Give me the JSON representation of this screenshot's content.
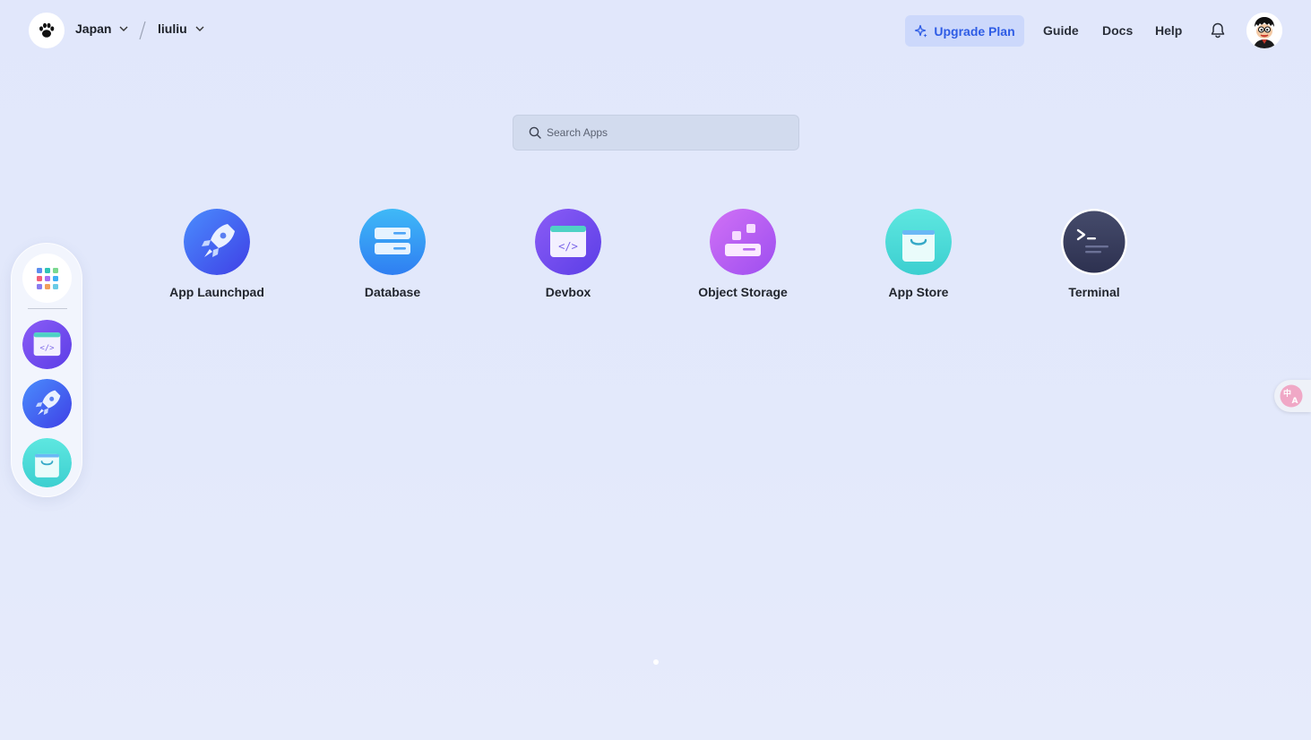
{
  "header": {
    "region": "Japan",
    "workspace": "liuliu",
    "upgrade_label": "Upgrade Plan",
    "nav": [
      "Guide",
      "Docs",
      "Help"
    ]
  },
  "search": {
    "placeholder": "Search Apps"
  },
  "apps": [
    {
      "label": "App Launchpad",
      "icon": "rocket-icon"
    },
    {
      "label": "Database",
      "icon": "database-icon"
    },
    {
      "label": "Devbox",
      "icon": "code-window-icon"
    },
    {
      "label": "Object Storage",
      "icon": "storage-blocks-icon"
    },
    {
      "label": "App Store",
      "icon": "shopping-bag-icon"
    },
    {
      "label": "Terminal",
      "icon": "terminal-icon"
    }
  ],
  "dock": [
    "apps-grid-icon",
    "code-window-icon",
    "rocket-icon",
    "shopping-bag-icon"
  ],
  "colors": {
    "background": "#e2e8fa",
    "accent": "#2e5ce5",
    "upgrade_bg": "#ccd8fb"
  },
  "pager": {
    "current_page": 1,
    "total_pages": 1
  }
}
